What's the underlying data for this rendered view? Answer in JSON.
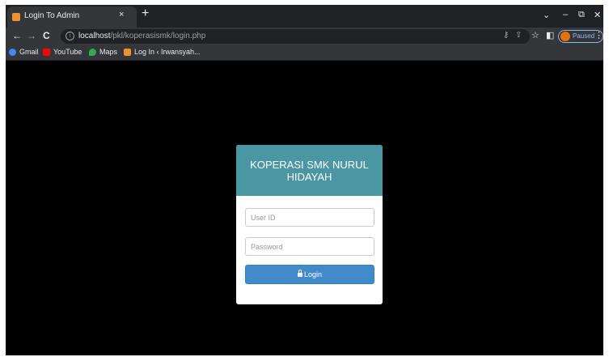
{
  "browser": {
    "tab": {
      "title": "Login To Admin",
      "close": "×"
    },
    "new_tab": "+",
    "window_controls": {
      "collapse": "⌄",
      "minimize": "–",
      "restore": "⧉",
      "close": "✕"
    },
    "nav": {
      "back": "←",
      "forward": "→",
      "reload": "C"
    },
    "address": {
      "info": "i",
      "host": "localhost",
      "path": "/pkl/koperasismk/login.php"
    },
    "omnibox_icons": {
      "key": "⚷",
      "share": "⇪",
      "star": "☆"
    },
    "sidepanel": "◧",
    "profile": {
      "label": "Paused"
    },
    "menu": "⋮",
    "bookmarks": [
      {
        "label": "Gmail",
        "icon": "google-icon",
        "color": "#4285f4"
      },
      {
        "label": "YouTube",
        "icon": "youtube-icon",
        "color": "#ff0000"
      },
      {
        "label": "Maps",
        "icon": "maps-icon",
        "color": "#34a853"
      },
      {
        "label": "Log In ‹ Irwansyah...",
        "icon": "site-icon",
        "color": "#f0912b"
      }
    ]
  },
  "login": {
    "title": "KOPERASI SMK NURUL HIDAYAH",
    "user_placeholder": "User ID",
    "password_placeholder": "Password",
    "button_label": "Login",
    "accent_color": "#4a96a3",
    "button_color": "#428bca"
  }
}
